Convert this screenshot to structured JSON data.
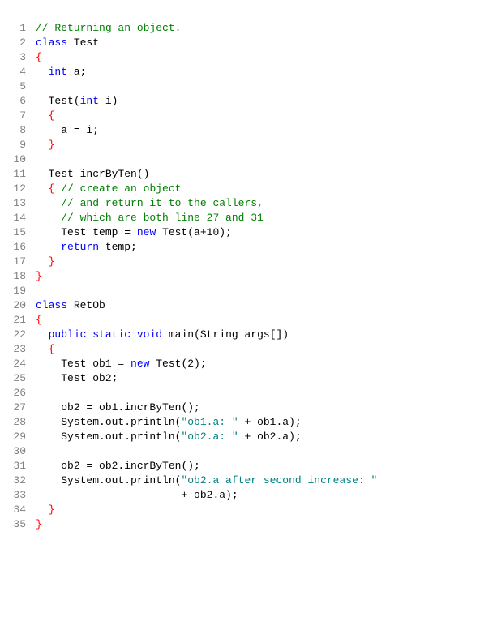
{
  "chart_data": null,
  "lines": [
    {
      "num": 1,
      "indent": 0,
      "tokens": [
        {
          "cls": "comment",
          "t": "// Returning an object."
        }
      ]
    },
    {
      "num": 2,
      "indent": 0,
      "tokens": [
        {
          "cls": "keyword",
          "t": "class"
        },
        {
          "cls": "plain",
          "t": " Test"
        }
      ]
    },
    {
      "num": 3,
      "indent": 0,
      "tokens": [
        {
          "cls": "brace",
          "t": "{"
        }
      ]
    },
    {
      "num": 4,
      "indent": 2,
      "tokens": [
        {
          "cls": "keyword",
          "t": "int"
        },
        {
          "cls": "plain",
          "t": " a;"
        }
      ]
    },
    {
      "num": 5,
      "indent": 0,
      "tokens": []
    },
    {
      "num": 6,
      "indent": 2,
      "tokens": [
        {
          "cls": "plain",
          "t": "Test("
        },
        {
          "cls": "keyword",
          "t": "int"
        },
        {
          "cls": "plain",
          "t": " i)"
        }
      ]
    },
    {
      "num": 7,
      "indent": 2,
      "tokens": [
        {
          "cls": "brace",
          "t": "{"
        }
      ]
    },
    {
      "num": 8,
      "indent": 4,
      "tokens": [
        {
          "cls": "plain",
          "t": "a = i;"
        }
      ]
    },
    {
      "num": 9,
      "indent": 2,
      "tokens": [
        {
          "cls": "brace",
          "t": "}"
        }
      ]
    },
    {
      "num": 10,
      "indent": 0,
      "tokens": []
    },
    {
      "num": 11,
      "indent": 2,
      "tokens": [
        {
          "cls": "plain",
          "t": "Test incrByTen()"
        }
      ]
    },
    {
      "num": 12,
      "indent": 2,
      "tokens": [
        {
          "cls": "brace",
          "t": "{"
        },
        {
          "cls": "plain",
          "t": " "
        },
        {
          "cls": "comment",
          "t": "// create an object"
        }
      ]
    },
    {
      "num": 13,
      "indent": 4,
      "tokens": [
        {
          "cls": "comment",
          "t": "// and return it to the callers,"
        }
      ]
    },
    {
      "num": 14,
      "indent": 4,
      "tokens": [
        {
          "cls": "comment",
          "t": "// which are both line 27 and 31"
        }
      ]
    },
    {
      "num": 15,
      "indent": 4,
      "tokens": [
        {
          "cls": "plain",
          "t": "Test temp = "
        },
        {
          "cls": "keyword",
          "t": "new"
        },
        {
          "cls": "plain",
          "t": " Test(a+10);"
        }
      ]
    },
    {
      "num": 16,
      "indent": 4,
      "tokens": [
        {
          "cls": "keyword",
          "t": "return"
        },
        {
          "cls": "plain",
          "t": " temp;"
        }
      ]
    },
    {
      "num": 17,
      "indent": 2,
      "tokens": [
        {
          "cls": "brace",
          "t": "}"
        }
      ]
    },
    {
      "num": 18,
      "indent": 0,
      "tokens": [
        {
          "cls": "brace",
          "t": "}"
        }
      ]
    },
    {
      "num": 19,
      "indent": 0,
      "tokens": []
    },
    {
      "num": 20,
      "indent": 0,
      "tokens": [
        {
          "cls": "keyword",
          "t": "class"
        },
        {
          "cls": "plain",
          "t": " RetOb"
        }
      ]
    },
    {
      "num": 21,
      "indent": 0,
      "tokens": [
        {
          "cls": "brace",
          "t": "{"
        }
      ]
    },
    {
      "num": 22,
      "indent": 2,
      "tokens": [
        {
          "cls": "keyword",
          "t": "public"
        },
        {
          "cls": "plain",
          "t": " "
        },
        {
          "cls": "keyword",
          "t": "static"
        },
        {
          "cls": "plain",
          "t": " "
        },
        {
          "cls": "keyword",
          "t": "void"
        },
        {
          "cls": "plain",
          "t": " main(String args[])"
        }
      ]
    },
    {
      "num": 23,
      "indent": 2,
      "tokens": [
        {
          "cls": "brace",
          "t": "{"
        }
      ]
    },
    {
      "num": 24,
      "indent": 4,
      "tokens": [
        {
          "cls": "plain",
          "t": "Test ob1 = "
        },
        {
          "cls": "keyword",
          "t": "new"
        },
        {
          "cls": "plain",
          "t": " Test(2);"
        }
      ]
    },
    {
      "num": 25,
      "indent": 4,
      "tokens": [
        {
          "cls": "plain",
          "t": "Test ob2;"
        }
      ]
    },
    {
      "num": 26,
      "indent": 0,
      "tokens": []
    },
    {
      "num": 27,
      "indent": 4,
      "tokens": [
        {
          "cls": "plain",
          "t": "ob2 = ob1.incrByTen();"
        }
      ]
    },
    {
      "num": 28,
      "indent": 4,
      "tokens": [
        {
          "cls": "plain",
          "t": "System.out.println("
        },
        {
          "cls": "string",
          "t": "\"ob1.a: \""
        },
        {
          "cls": "plain",
          "t": " + ob1.a);"
        }
      ]
    },
    {
      "num": 29,
      "indent": 4,
      "tokens": [
        {
          "cls": "plain",
          "t": "System.out.println("
        },
        {
          "cls": "string",
          "t": "\"ob2.a: \""
        },
        {
          "cls": "plain",
          "t": " + ob2.a);"
        }
      ]
    },
    {
      "num": 30,
      "indent": 0,
      "tokens": []
    },
    {
      "num": 31,
      "indent": 4,
      "tokens": [
        {
          "cls": "plain",
          "t": "ob2 = ob2.incrByTen();"
        }
      ]
    },
    {
      "num": 32,
      "indent": 4,
      "tokens": [
        {
          "cls": "plain",
          "t": "System.out.println("
        },
        {
          "cls": "string",
          "t": "\"ob2.a after second increase: \""
        }
      ]
    },
    {
      "num": 33,
      "indent": 23,
      "tokens": [
        {
          "cls": "plain",
          "t": "+ ob2.a);"
        }
      ]
    },
    {
      "num": 34,
      "indent": 2,
      "tokens": [
        {
          "cls": "brace",
          "t": "}"
        }
      ]
    },
    {
      "num": 35,
      "indent": 0,
      "tokens": [
        {
          "cls": "brace",
          "t": "}"
        }
      ]
    }
  ]
}
